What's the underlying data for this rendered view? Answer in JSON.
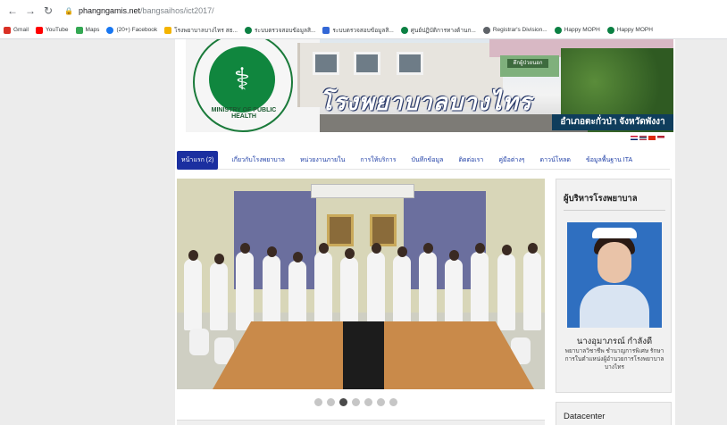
{
  "browser": {
    "url_host": "phangngamis.net",
    "url_path": "/bangsaihos/ict2017/",
    "bookmarks": [
      {
        "label": "Gmail",
        "color": "#d93025"
      },
      {
        "label": "YouTube",
        "color": "#ff0000"
      },
      {
        "label": "Maps",
        "color": "#34a853"
      },
      {
        "label": "(20+) Facebook",
        "color": "#1877f2"
      },
      {
        "label": "โรงพยาบาลบางไทร สธ...",
        "color": "#f4b400"
      },
      {
        "label": "ระบบตรวจสอบข้อมูลสิ...",
        "color": "#0b8043"
      },
      {
        "label": "ระบบตรวจสอบข้อมูลสิ...",
        "color": "#3367d6"
      },
      {
        "label": "ศูนย์ปฏิบัติการทางด้านก...",
        "color": "#0b8043"
      },
      {
        "label": "Registrar's Division...",
        "color": "#5f6368"
      },
      {
        "label": "Happy MOPH",
        "color": "#0b8043"
      },
      {
        "label": "Happy MOPH",
        "color": "#0b8043"
      }
    ]
  },
  "header": {
    "logo_text": "MINISTRY OF PUBLIC HEALTH",
    "hospital_name": "โรงพยาบาลบางไทร",
    "location": "อำเภอตะกั่วป่า จังหวัดพังงา",
    "sign_text": "ตึกผู้ป่วยนอก"
  },
  "nav": {
    "items": [
      {
        "label": "หน้าแรก (2)",
        "active": true
      },
      {
        "label": "เกี่ยวกับโรงพยาบาล",
        "active": false
      },
      {
        "label": "หน่วยงานภายใน",
        "active": false
      },
      {
        "label": "การให้บริการ",
        "active": false
      },
      {
        "label": "บันทึกข้อมูล",
        "active": false
      },
      {
        "label": "ติดต่อเรา",
        "active": false
      },
      {
        "label": "คู่มือต่างๆ",
        "active": false
      },
      {
        "label": "ดาวน์โหลด",
        "active": false
      },
      {
        "label": "ข้อมูลพื้นฐาน ITA",
        "active": false
      }
    ]
  },
  "carousel": {
    "slide_count": 7,
    "active_index": 2
  },
  "sidebar": {
    "title": "ผู้บริหารโรงพยาบาล",
    "name": "นางอุมาภรณ์ กำลังดี",
    "role": "พยาบาลวิชาชีพ ชำนาญการพิเศษ รักษาการในตำแหน่งผู้อำนวยการโรงพยาบาลบางไทร"
  },
  "datacenter": {
    "title": "Datacenter"
  },
  "colors": {
    "nav_active": "#1b2fa0",
    "nav_link": "#1f3fa6",
    "logo_green": "#10863e"
  }
}
